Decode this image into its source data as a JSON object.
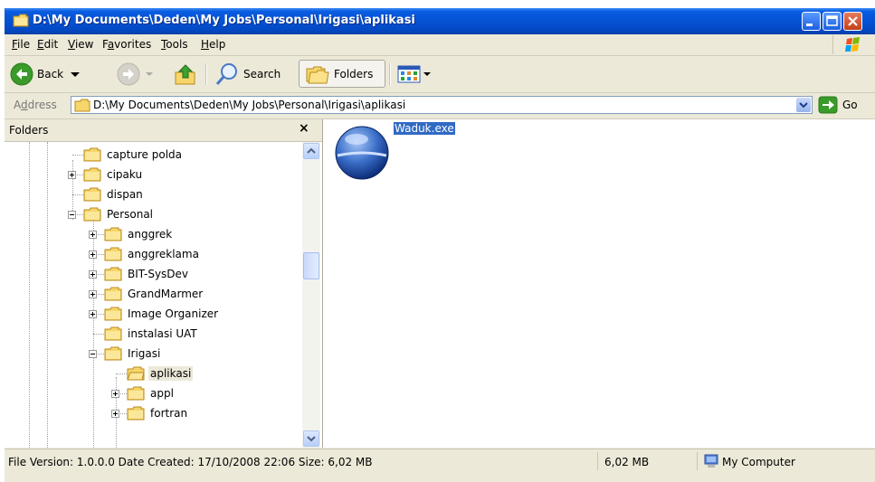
{
  "window": {
    "title": "D:\\My Documents\\Deden\\My Jobs\\Personal\\Irigasi\\aplikasi"
  },
  "menu": [
    {
      "pre": "",
      "u": "F",
      "post": "ile"
    },
    {
      "pre": "",
      "u": "E",
      "post": "dit"
    },
    {
      "pre": "",
      "u": "V",
      "post": "iew"
    },
    {
      "pre": "F",
      "u": "a",
      "post": "vorites"
    },
    {
      "pre": "",
      "u": "T",
      "post": "ools"
    },
    {
      "pre": "",
      "u": "H",
      "post": "elp"
    }
  ],
  "toolbar": {
    "back_label": "Back",
    "search_label": "Search",
    "folders_label": "Folders"
  },
  "address": {
    "label_pre": "A",
    "label_u": "d",
    "label_post": "dress",
    "path": "D:\\My Documents\\Deden\\My Jobs\\Personal\\Irigasi\\aplikasi",
    "go_label": "Go"
  },
  "folders_pane": {
    "title": "Folders",
    "close_glyph": "×",
    "tree": [
      {
        "label": "capture polda",
        "level": 0,
        "expander": "none",
        "selected": false
      },
      {
        "label": "cipaku",
        "level": 0,
        "expander": "plus",
        "selected": false
      },
      {
        "label": "dispan",
        "level": 0,
        "expander": "none",
        "selected": false
      },
      {
        "label": "Personal",
        "level": 0,
        "expander": "minus",
        "selected": false
      },
      {
        "label": "anggrek",
        "level": 1,
        "expander": "plus",
        "selected": false
      },
      {
        "label": "anggreklama",
        "level": 1,
        "expander": "plus",
        "selected": false
      },
      {
        "label": "BIT-SysDev",
        "level": 1,
        "expander": "plus",
        "selected": false
      },
      {
        "label": "GrandMarmer",
        "level": 1,
        "expander": "plus",
        "selected": false
      },
      {
        "label": "Image Organizer",
        "level": 1,
        "expander": "plus",
        "selected": false
      },
      {
        "label": "instalasi UAT",
        "level": 1,
        "expander": "none",
        "selected": false
      },
      {
        "label": "Irigasi",
        "level": 1,
        "expander": "minus",
        "selected": false
      },
      {
        "label": "aplikasi",
        "level": 2,
        "expander": "none",
        "selected": true
      },
      {
        "label": "appl",
        "level": 2,
        "expander": "plus",
        "selected": false
      },
      {
        "label": "fortran",
        "level": 2,
        "expander": "plus",
        "selected": false
      }
    ]
  },
  "content": {
    "files": [
      {
        "name": "Waduk.exe",
        "icon": "application-globe-icon",
        "selected": true
      }
    ]
  },
  "statusbar": {
    "info": "File Version: 1.0.0.0 Date Created: 17/10/2008 22:06 Size: 6,02 MB",
    "size": "6,02 MB",
    "location": "My Computer"
  },
  "colors": {
    "titlebar": "#0452d4",
    "chrome": "#ece9d8",
    "selection": "#316ac5"
  }
}
